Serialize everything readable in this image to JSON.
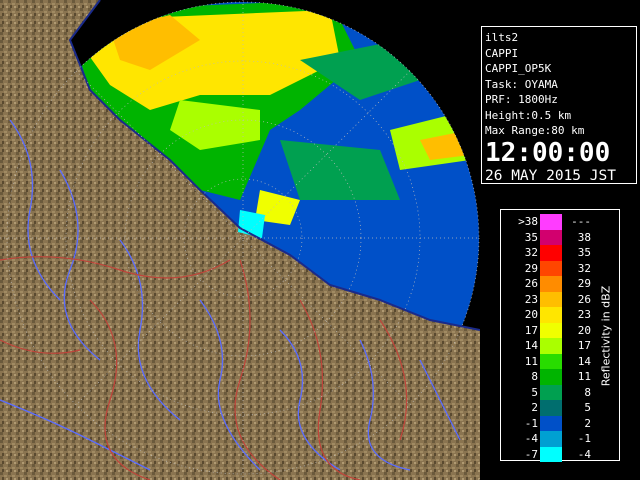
{
  "info": {
    "radar_name": "ilts2",
    "product": "CAPPI",
    "product_name": "CAPPI_OP5K",
    "task": "Task: OYAMA",
    "prf": "PRF: 1800Hz",
    "height": "Height:0.5 km",
    "max_range": "Max Range:80 km",
    "time": "12:00:00",
    "date": "26 MAY 2015 JST"
  },
  "legend": {
    "title": "Reflectivity in dBZ",
    "rows": [
      {
        "low": ">38",
        "high": "---",
        "color": "#ff3cff"
      },
      {
        "low": "35",
        "high": "38",
        "color": "#d2006e"
      },
      {
        "low": "32",
        "high": "35",
        "color": "#ff0000"
      },
      {
        "low": "29",
        "high": "32",
        "color": "#ff4600"
      },
      {
        "low": "26",
        "high": "29",
        "color": "#ff8c00"
      },
      {
        "low": "23",
        "high": "26",
        "color": "#ffbe00"
      },
      {
        "low": "20",
        "high": "23",
        "color": "#ffe600"
      },
      {
        "low": "17",
        "high": "20",
        "color": "#f0ff00"
      },
      {
        "low": "14",
        "high": "17",
        "color": "#aaff00"
      },
      {
        "low": "11",
        "high": "14",
        "color": "#28dc00"
      },
      {
        "low": "8",
        "high": "11",
        "color": "#00b400"
      },
      {
        "low": "5",
        "high": "8",
        "color": "#00a050"
      },
      {
        "low": "2",
        "high": "5",
        "color": "#006e6e"
      },
      {
        "low": "-1",
        "high": "2",
        "color": "#0050c8"
      },
      {
        "low": "-4",
        "high": "-1",
        "color": "#00a0d2"
      },
      {
        "low": "-7",
        "high": "-4",
        "color": "#00ffff"
      }
    ]
  },
  "map": {
    "land_color": "#8a7450",
    "sea_color": "#000000",
    "river_color": "#5a6cff",
    "border_color": "#c0443a",
    "coast_color": "#1a2a8a"
  }
}
